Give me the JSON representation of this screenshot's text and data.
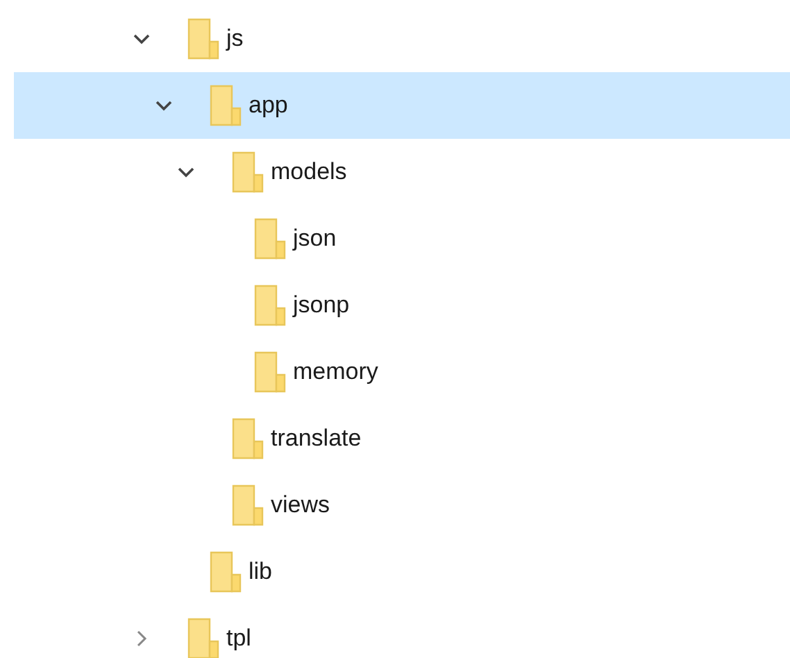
{
  "tree": [
    {
      "label": "js",
      "expanded": true,
      "selected": false,
      "children": [
        {
          "label": "app",
          "expanded": true,
          "selected": true,
          "children": [
            {
              "label": "models",
              "expanded": true,
              "selected": false,
              "children": [
                {
                  "label": "json",
                  "selected": false
                },
                {
                  "label": "jsonp",
                  "selected": false
                },
                {
                  "label": "memory",
                  "selected": false
                }
              ]
            },
            {
              "label": "translate",
              "selected": false
            },
            {
              "label": "views",
              "selected": false
            }
          ]
        },
        {
          "label": "lib",
          "selected": false
        }
      ]
    },
    {
      "label": "tpl",
      "expanded": false,
      "selected": false
    }
  ]
}
